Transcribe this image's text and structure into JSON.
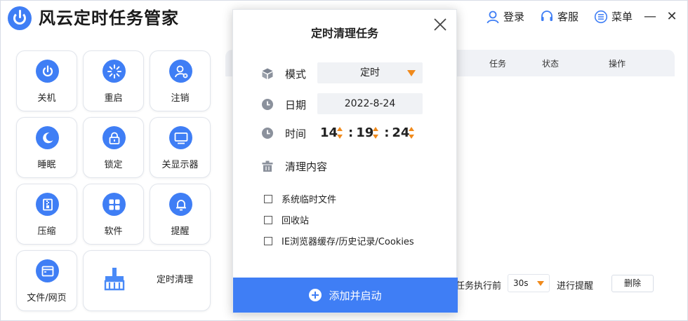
{
  "app": {
    "title": "风云定时任务管家"
  },
  "topbar": {
    "login": "登录",
    "service": "客服",
    "menu": "菜单",
    "minimize": "—",
    "close": "✕"
  },
  "tiles": [
    {
      "label": "关机",
      "icon": "power-icon"
    },
    {
      "label": "重启",
      "icon": "restart-icon"
    },
    {
      "label": "注销",
      "icon": "logout-user-icon"
    },
    {
      "label": "睡眠",
      "icon": "moon-icon"
    },
    {
      "label": "锁定",
      "icon": "lock-icon"
    },
    {
      "label": "关显示器",
      "icon": "monitor-icon"
    },
    {
      "label": "压缩",
      "icon": "archive-icon"
    },
    {
      "label": "软件",
      "icon": "apps-icon"
    },
    {
      "label": "提醒",
      "icon": "bell-icon"
    },
    {
      "label": "文件/网页",
      "icon": "browser-icon"
    },
    {
      "label": "定时清理",
      "icon": "broom-icon"
    }
  ],
  "table": {
    "columns": [
      "任务",
      "状态",
      "操作"
    ],
    "footer": {
      "prefix": "任务执行前",
      "select_value": "30s",
      "suffix": "进行提醒",
      "delete": "删除"
    }
  },
  "modal": {
    "title": "定时清理任务",
    "mode_label": "模式",
    "mode_value": "定时",
    "date_label": "日期",
    "date_value": "2022-8-24",
    "time_label": "时间",
    "time": {
      "hour": "14",
      "minute": "19",
      "second": "24"
    },
    "clean_label": "清理内容",
    "options": [
      "系统临时文件",
      "回收站",
      "IE浏览器缓存/历史记录/Cookies"
    ],
    "submit": "添加并启动"
  },
  "colors": {
    "accent": "#3f7ef5",
    "caret": "#f08a1c"
  }
}
